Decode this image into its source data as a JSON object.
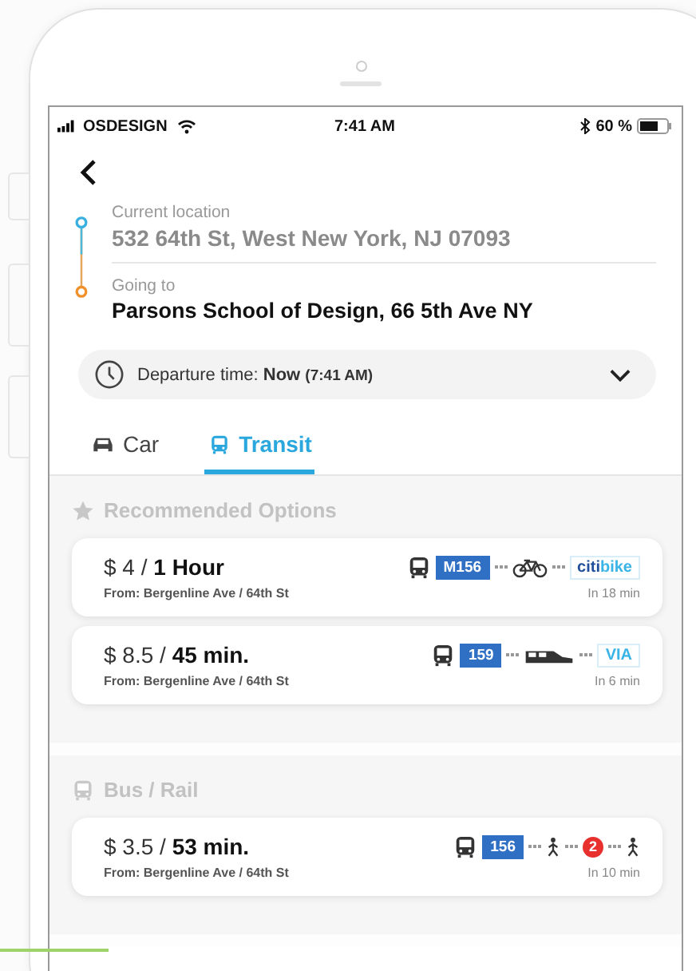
{
  "status_bar": {
    "carrier": "OSDESIGN",
    "time": "7:41 AM",
    "battery": "60 %"
  },
  "route": {
    "from_label": "Current location",
    "from": "532 64th St, West New York, NJ 07093",
    "to_label": "Going to",
    "to": "Parsons School of Design, 66 5th Ave NY"
  },
  "departure": {
    "label": "Departure time:",
    "value": "Now",
    "detail": "(7:41 AM)"
  },
  "tabs": [
    {
      "label": "Car",
      "kind": "car",
      "selected": false
    },
    {
      "label": "Transit",
      "kind": "transit",
      "selected": true
    }
  ],
  "sections": [
    {
      "title": "Recommended Options",
      "kind": "star",
      "options": [
        {
          "price": "$ 4 /",
          "duration": "1 Hour",
          "from": "From: Bergenline Ave / 64th St",
          "eta": "In 18 min",
          "legs": [
            {
              "kind": "bus"
            },
            {
              "kind": "route",
              "text": "M156",
              "color": "#2f6fc4"
            },
            {
              "kind": "bike"
            },
            {
              "kind": "brand",
              "parts": [
                "citi",
                "bike"
              ]
            }
          ]
        },
        {
          "price": "$ 8.5 /",
          "duration": "45 min.",
          "from": "From: Bergenline Ave / 64th St",
          "eta": "In 6 min",
          "legs": [
            {
              "kind": "bus"
            },
            {
              "kind": "route",
              "text": "159",
              "color": "#2f6fc4"
            },
            {
              "kind": "car"
            },
            {
              "kind": "brand",
              "parts": [
                "VIA"
              ]
            }
          ]
        }
      ]
    },
    {
      "title": "Bus / Rail",
      "kind": "bus",
      "options": [
        {
          "price": "$ 3.5 /",
          "duration": "53 min.",
          "from": "From: Bergenline Ave / 64th St",
          "eta": "In 10 min",
          "legs": [
            {
              "kind": "bus"
            },
            {
              "kind": "route",
              "text": "156",
              "color": "#2f6fc4"
            },
            {
              "kind": "walk"
            },
            {
              "kind": "line",
              "text": "2",
              "color": "#e8302f"
            },
            {
              "kind": "walk"
            }
          ]
        }
      ]
    }
  ]
}
